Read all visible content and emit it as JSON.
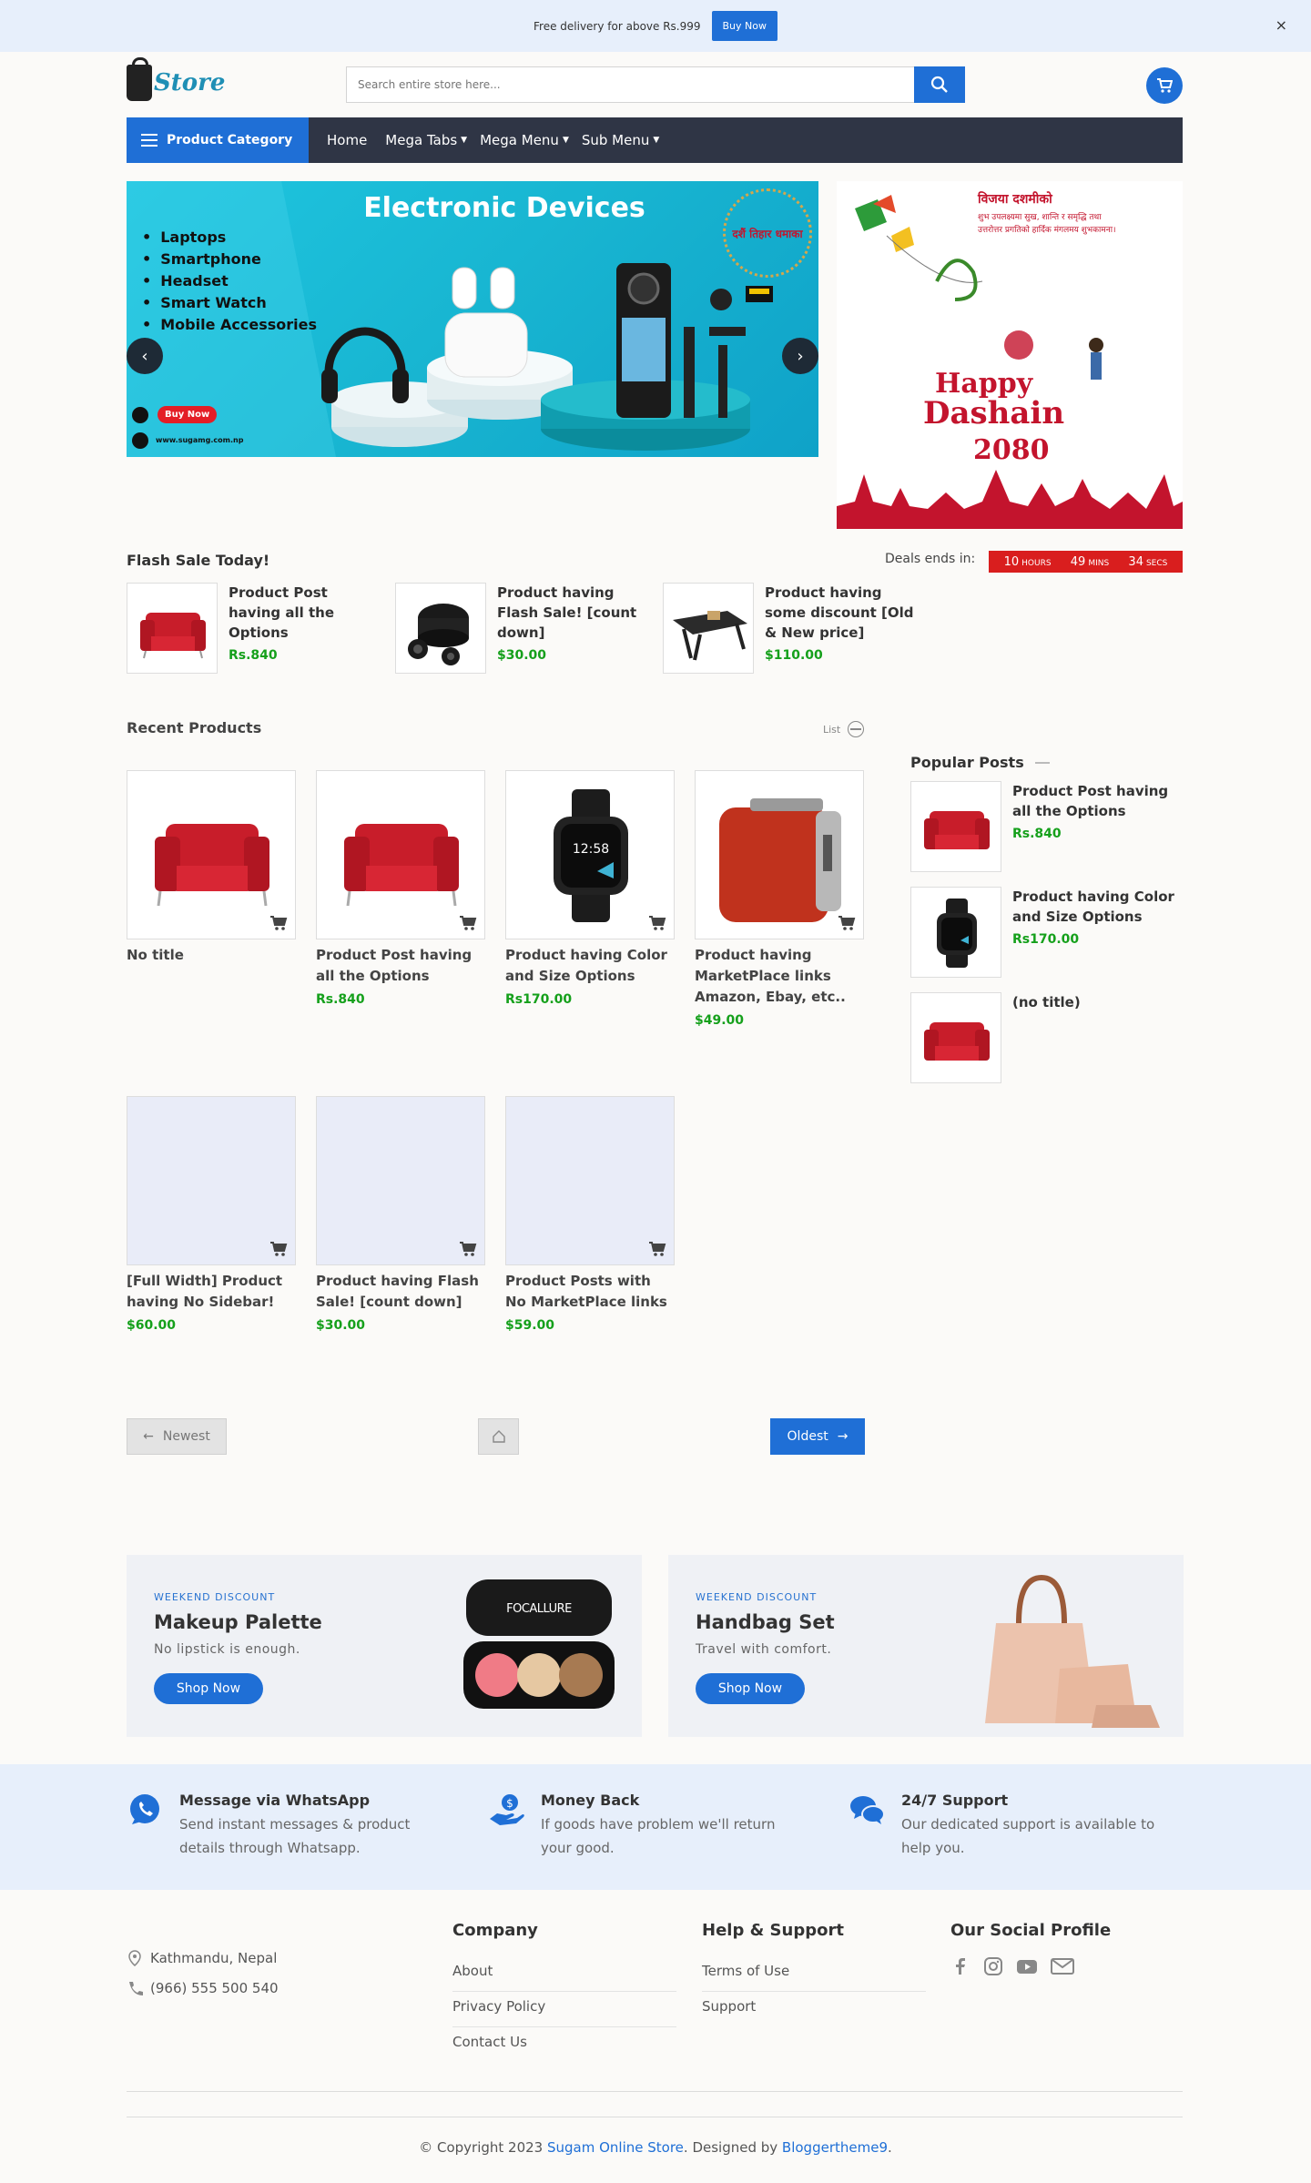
{
  "topbar": {
    "text": "Free delivery for above Rs.999",
    "button": "Buy Now",
    "close": "×"
  },
  "header": {
    "logo_text": "Store",
    "search_placeholder": "Search entire store here..."
  },
  "nav": {
    "category": "Product Category",
    "items": [
      {
        "label": "Home",
        "has_caret": false
      },
      {
        "label": "Mega Tabs",
        "has_caret": true
      },
      {
        "label": "Mega Menu",
        "has_caret": true
      },
      {
        "label": "Sub Menu",
        "has_caret": true
      }
    ]
  },
  "slider": {
    "title": "Electronic Devices",
    "bullets": [
      "Laptops",
      "Smartphone",
      "Headset",
      "Smart Watch",
      "Mobile Accessories"
    ],
    "buy_now": "Buy Now",
    "site": "www.sugamg.com.np",
    "promo_tag": "दशैं तिहार धमाका"
  },
  "dashain": {
    "line1": "विजया दशमीको",
    "line2": "शुभ उपलक्ष्यमा सुख, शान्ति र समृद्धि तथा",
    "line3": "उत्तरोत्तर प्रगतिको हार्दिक मंगलमय शुभकामना।",
    "happy": "Happy",
    "dashain": "Dashain",
    "year": "2080"
  },
  "flash": {
    "title": "Flash Sale Today!",
    "deals_label": "Deals ends in:",
    "timer": [
      {
        "value": "10",
        "unit": "HOURS"
      },
      {
        "value": "49",
        "unit": "MINS"
      },
      {
        "value": "34",
        "unit": "SECS"
      }
    ],
    "items": [
      {
        "title": "Product Post having all the Options",
        "price": "Rs.840",
        "image": "red-armchair"
      },
      {
        "title": "Product having Flash Sale! [count down]",
        "price": "$30.00",
        "image": "earbuds-case"
      },
      {
        "title": "Product having some discount [Old & New price]",
        "price": "$110.00",
        "image": "laptop-table"
      }
    ]
  },
  "recent": {
    "title": "Recent Products",
    "list_toggle": "List",
    "products": [
      {
        "title": "No title",
        "price": "",
        "image": "red-armchair"
      },
      {
        "title": "Product Post having all the Options",
        "price": "Rs.840",
        "image": "red-armchair"
      },
      {
        "title": "Product having Color and Size Options",
        "price": "Rs170.00",
        "image": "smartwatch"
      },
      {
        "title": "Product having MarketPlace links Amazon, Ebay, etc..",
        "price": "$49.00",
        "image": "red-toaster"
      },
      {
        "title": "[Full Width] Product having No Sidebar!",
        "price": "$60.00",
        "image": ""
      },
      {
        "title": "Product having Flash Sale! [count down]",
        "price": "$30.00",
        "image": ""
      },
      {
        "title": "Product Posts with No MarketPlace links",
        "price": "$59.00",
        "image": ""
      }
    ]
  },
  "popular": {
    "title": "Popular Posts",
    "posts": [
      {
        "title": "Product Post having all the Options",
        "price": "Rs.840",
        "image": "red-armchair"
      },
      {
        "title": "Product having Color and Size Options",
        "price": "Rs170.00",
        "image": "smartwatch"
      },
      {
        "title": "(no title)",
        "price": "",
        "image": "red-armchair"
      }
    ]
  },
  "pager": {
    "newest": "Newest",
    "oldest": "Oldest"
  },
  "banners": [
    {
      "tag": "WEEKEND DISCOUNT",
      "title": "Makeup Palette",
      "subtitle": "No lipstick is enough.",
      "button": "Shop Now",
      "image_text": "FOCALLURE"
    },
    {
      "tag": "WEEKEND DISCOUNT",
      "title": "Handbag Set",
      "subtitle": "Travel with comfort.",
      "button": "Shop Now"
    }
  ],
  "features": [
    {
      "title": "Message via WhatsApp",
      "desc": "Send instant messages & product details through Whatsapp.",
      "icon": "whatsapp-icon"
    },
    {
      "title": "Money Back",
      "desc": "If goods have problem we'll return your good.",
      "icon": "money-back-icon"
    },
    {
      "title": "24/7 Support",
      "desc": "Our dedicated support is available to help you.",
      "icon": "chat-icon"
    }
  ],
  "footer": {
    "address": "Kathmandu, Nepal",
    "phone": "(966) 555 500 540",
    "company": {
      "title": "Company",
      "links": [
        "About",
        "Privacy Policy",
        "Contact Us"
      ]
    },
    "help": {
      "title": "Help & Support",
      "links": [
        "Terms of Use",
        "Support"
      ]
    },
    "social": {
      "title": "Our Social Profile",
      "icons": [
        "facebook-icon",
        "instagram-icon",
        "youtube-icon",
        "mail-icon"
      ]
    },
    "copyright_prefix": "© Copyright 2023 ",
    "store_link": "Sugam Online Store",
    "copyright_mid": ". Designed by ",
    "designer_link": "Bloggertheme9",
    "copyright_suffix": "."
  },
  "colors": {
    "accent": "#1f6fd6",
    "price": "#15a01b",
    "nav_bg": "#2f3545",
    "timer": "#d91e1e"
  }
}
